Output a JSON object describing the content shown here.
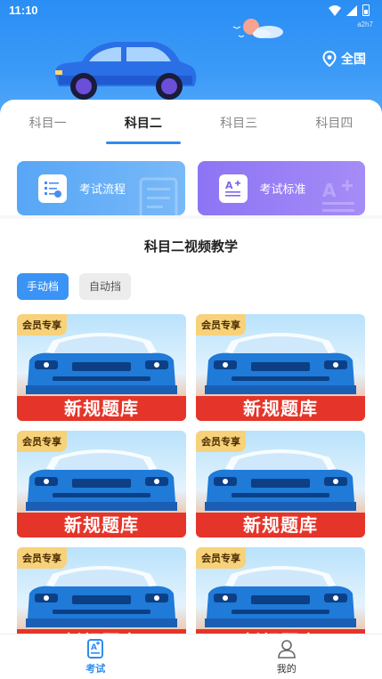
{
  "status": {
    "time": "11:10",
    "code": "a2h7"
  },
  "header": {
    "location_label": "全国"
  },
  "tabs": [
    {
      "label": "科目一",
      "active": false
    },
    {
      "label": "科目二",
      "active": true
    },
    {
      "label": "科目三",
      "active": false
    },
    {
      "label": "科目四",
      "active": false
    }
  ],
  "tiles": [
    {
      "label": "考试流程",
      "icon": "checklist-icon"
    },
    {
      "label": "考试标准",
      "icon": "document-icon"
    }
  ],
  "section": {
    "title": "科目二视频教学"
  },
  "filters": [
    {
      "label": "手动档",
      "active": true
    },
    {
      "label": "自动挡",
      "active": false
    }
  ],
  "videos": [
    {
      "badge": "会员专享",
      "banner": "新规题库"
    },
    {
      "badge": "会员专享",
      "banner": "新规题库"
    },
    {
      "badge": "会员专享",
      "banner": "新规题库"
    },
    {
      "badge": "会员专享",
      "banner": "新规题库"
    },
    {
      "badge": "会员专享",
      "banner": "新规题库"
    },
    {
      "badge": "会员专享",
      "banner": "新规题库"
    }
  ],
  "bottom_nav": [
    {
      "label": "考试",
      "icon": "exam-icon",
      "active": true
    },
    {
      "label": "我的",
      "icon": "user-icon",
      "active": false
    }
  ],
  "colors": {
    "primary": "#2d8cf0",
    "banner_red": "#e5352a",
    "badge_gold": "#f7d27a",
    "tile_purple": "#8d74f4"
  }
}
